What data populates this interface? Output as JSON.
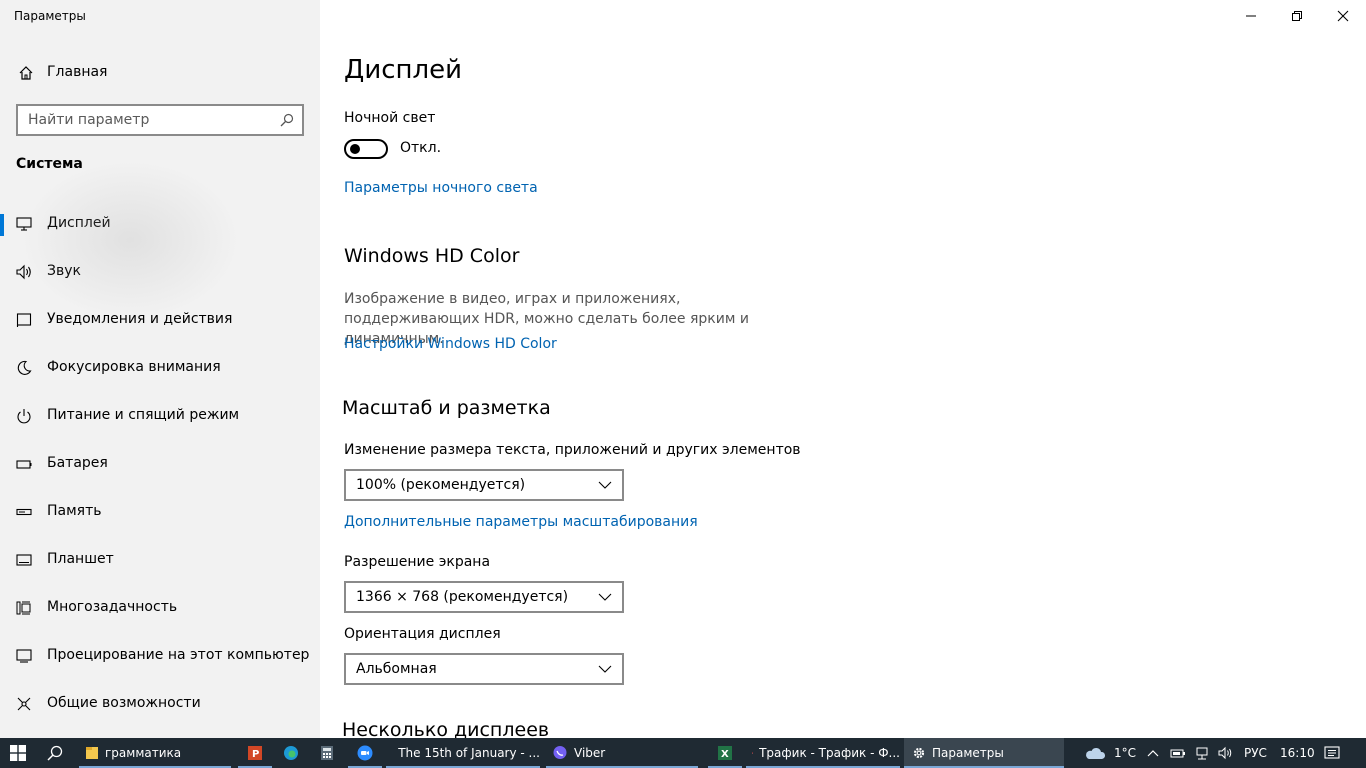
{
  "window": {
    "title": "Параметры"
  },
  "sidebar": {
    "home_label": "Главная",
    "search_placeholder": "Найти параметр",
    "section_title": "Система",
    "items": [
      {
        "label": "Дисплей",
        "icon": "monitor-icon",
        "active": true
      },
      {
        "label": "Звук",
        "icon": "speaker-icon"
      },
      {
        "label": "Уведомления и действия",
        "icon": "notifications-icon"
      },
      {
        "label": "Фокусировка внимания",
        "icon": "moon-icon"
      },
      {
        "label": "Питание и спящий режим",
        "icon": "power-icon"
      },
      {
        "label": "Батарея",
        "icon": "battery-icon"
      },
      {
        "label": "Память",
        "icon": "storage-icon"
      },
      {
        "label": "Планшет",
        "icon": "tablet-icon"
      },
      {
        "label": "Многозадачность",
        "icon": "multitasking-icon"
      },
      {
        "label": "Проецирование на этот компьютер",
        "icon": "projecting-icon"
      },
      {
        "label": "Общие возможности",
        "icon": "shared-experiences-icon"
      }
    ]
  },
  "main": {
    "title": "Дисплей",
    "night_light": {
      "label": "Ночной свет",
      "toggle_state": "Откл.",
      "settings_link": "Параметры ночного света"
    },
    "hd_color": {
      "title": "Windows HD Color",
      "description": "Изображение в видео, играх и приложениях, поддерживающих HDR, можно сделать более ярким и динамичным.",
      "link": "Настройки Windows HD Color"
    },
    "scale_layout": {
      "title": "Масштаб и разметка",
      "scale_label": "Изменение размера текста, приложений и других элементов",
      "scale_value": "100% (рекомендуется)",
      "advanced_link": "Дополнительные параметры масштабирования",
      "resolution_label": "Разрешение экрана",
      "resolution_value": "1366 × 768 (рекомендуется)",
      "orientation_label": "Ориентация дисплея",
      "orientation_value": "Альбомная"
    },
    "multi_displays_title": "Несколько дисплеев"
  },
  "taskbar": {
    "items": [
      {
        "label": "грамматика",
        "icon": "folder-icon"
      },
      {
        "label": "",
        "icon": "powerpoint-icon"
      },
      {
        "label": "",
        "icon": "edge-icon"
      },
      {
        "label": "",
        "icon": "calculator-icon"
      },
      {
        "label": "",
        "icon": "zoom-icon"
      },
      {
        "label": "The 15th of January - ...",
        "icon": "word-icon"
      },
      {
        "label": "Viber",
        "icon": "viber-icon"
      },
      {
        "label": "",
        "icon": "excel-icon"
      },
      {
        "label": "Трафик - Трафик - Ф...",
        "icon": "yandex-browser-icon"
      },
      {
        "label": "Параметры",
        "icon": "settings-gear-icon"
      }
    ],
    "tray": {
      "temperature": "1°C",
      "language": "РУС",
      "time": "16:10"
    }
  }
}
